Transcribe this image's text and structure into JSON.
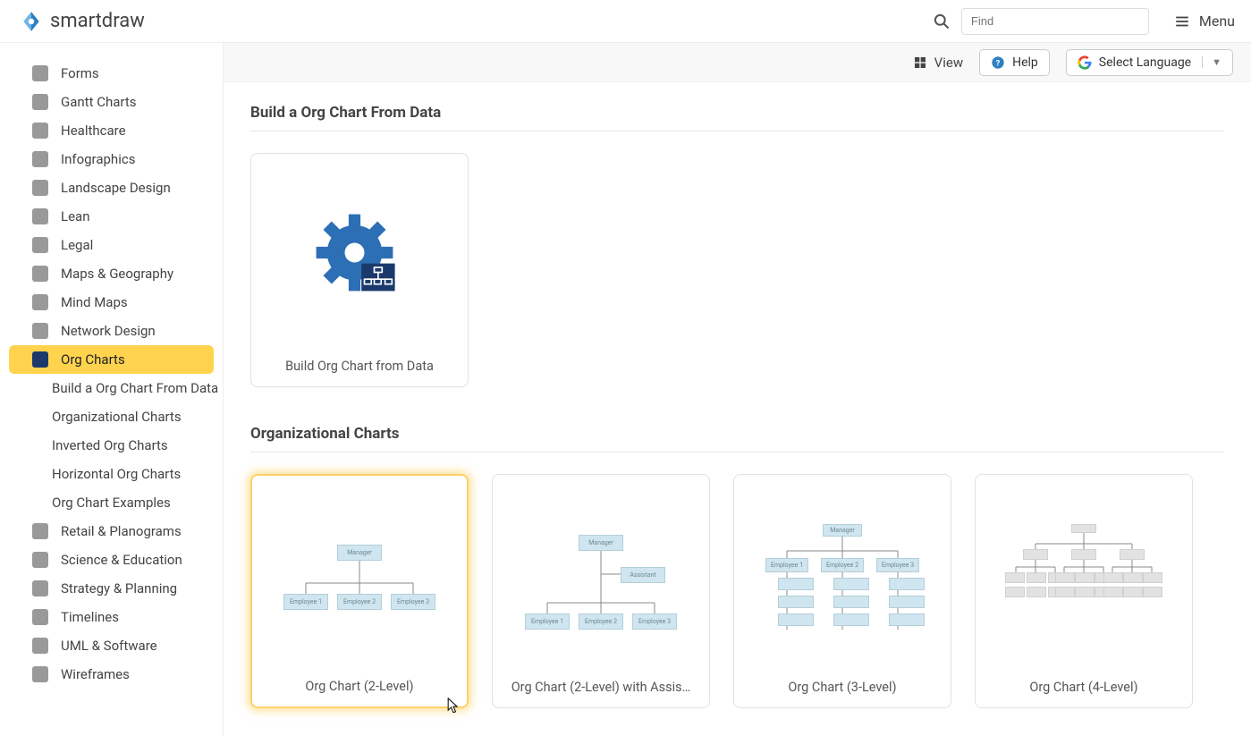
{
  "brand": "smartdraw",
  "search": {
    "placeholder": "Find"
  },
  "menu_label": "Menu",
  "toolbar": {
    "view": "View",
    "help": "Help",
    "select_language": "Select Language"
  },
  "sidebar": {
    "items": [
      "Forms",
      "Gantt Charts",
      "Healthcare",
      "Infographics",
      "Landscape Design",
      "Lean",
      "Legal",
      "Maps & Geography",
      "Mind Maps",
      "Network Design",
      "Org Charts",
      "Retail & Planograms",
      "Science & Education",
      "Strategy & Planning",
      "Timelines",
      "UML & Software",
      "Wireframes"
    ],
    "active_index": 10,
    "subitems": [
      "Build a Org Chart From Data",
      "Organizational Charts",
      "Inverted Org Charts",
      "Horizontal Org Charts",
      "Org Chart Examples"
    ]
  },
  "sections": [
    {
      "title": "Build a Org Chart From Data",
      "cards": [
        {
          "caption": "Build Org Chart from Data",
          "kind": "gear"
        }
      ]
    },
    {
      "title": "Organizational Charts",
      "cards": [
        {
          "caption": "Org Chart (2-Level)",
          "kind": "org2",
          "selected": true,
          "cursor": true
        },
        {
          "caption": "Org Chart (2-Level) with Assis…",
          "kind": "org2a"
        },
        {
          "caption": "Org Chart (3-Level)",
          "kind": "org3"
        },
        {
          "caption": "Org Chart (4-Level)",
          "kind": "org4"
        }
      ]
    }
  ]
}
